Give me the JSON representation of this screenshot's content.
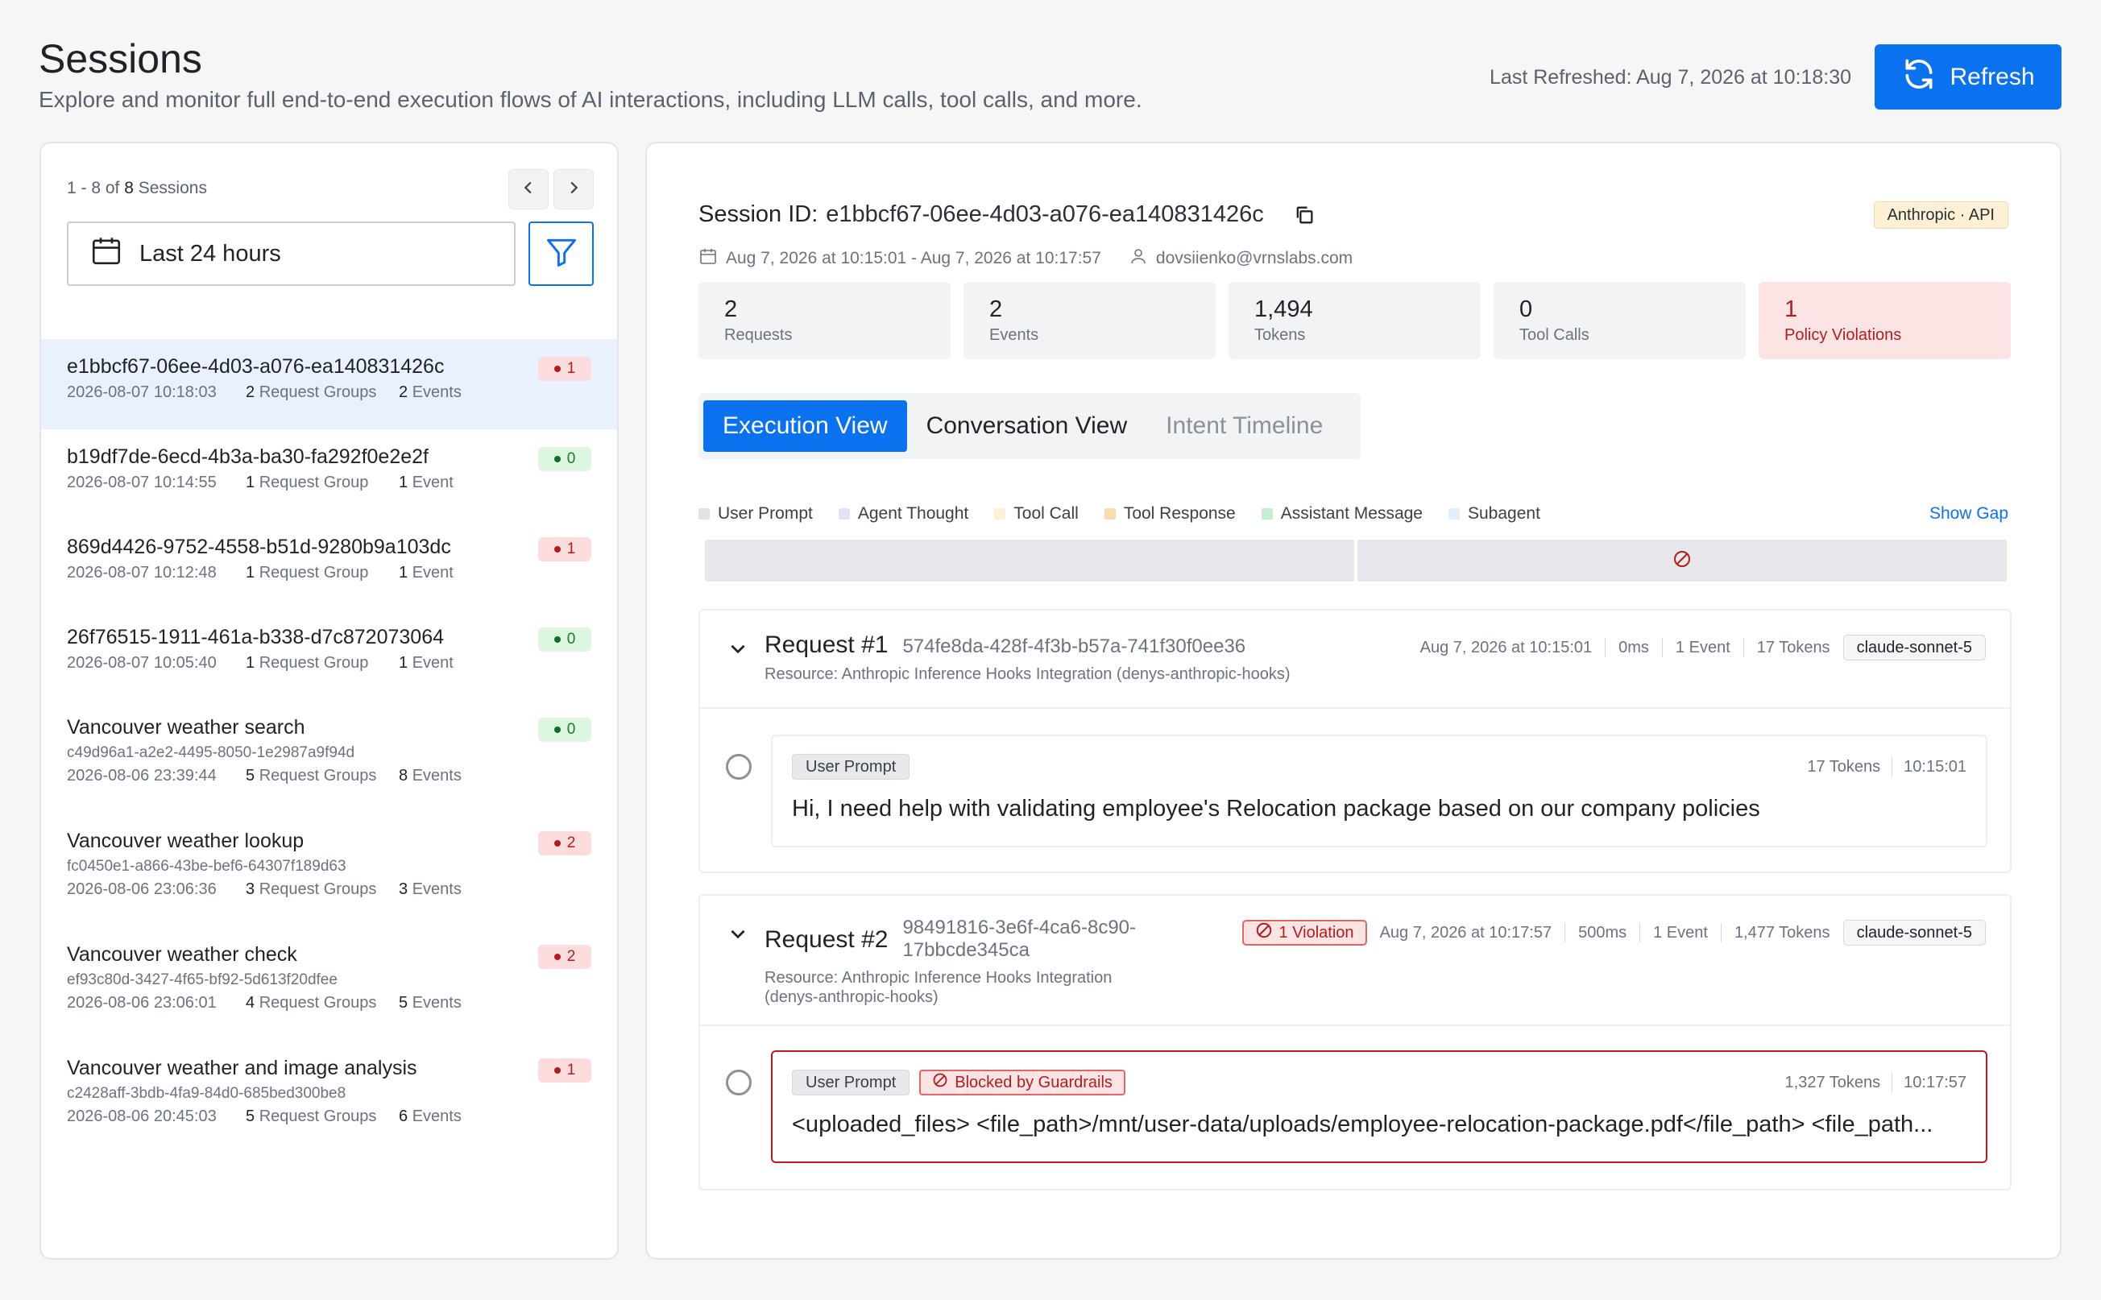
{
  "header": {
    "title": "Sessions",
    "subtitle": "Explore and monitor full end-to-end execution flows of AI interactions, including LLM calls, tool calls, and more.",
    "last_refreshed": "Last Refreshed: Aug 7, 2026 at 10:18:30",
    "refresh_label": "Refresh",
    "accent": "#0a72ef"
  },
  "left": {
    "count_prefix": "1 - 8 of",
    "count_total": "8",
    "count_suffix": "Sessions",
    "date_filter": "Last 24 hours",
    "sessions": [
      {
        "title": "e1bbcf67-06ee-4d03-a076-ea140831426c",
        "sub": "",
        "time": "2026-08-07 10:18:03",
        "groups_n": "2",
        "groups_label": "Request Groups",
        "events_n": "2",
        "events_label": "Events",
        "badge": "1",
        "badge_color": "red",
        "selected": true
      },
      {
        "title": "b19df7de-6ecd-4b3a-ba30-fa292f0e2e2f",
        "sub": "",
        "time": "2026-08-07 10:14:55",
        "groups_n": "1",
        "groups_label": "Request Group",
        "events_n": "1",
        "events_label": "Event",
        "badge": "0",
        "badge_color": "green"
      },
      {
        "title": "869d4426-9752-4558-b51d-9280b9a103dc",
        "sub": "",
        "time": "2026-08-07 10:12:48",
        "groups_n": "1",
        "groups_label": "Request Group",
        "events_n": "1",
        "events_label": "Event",
        "badge": "1",
        "badge_color": "red"
      },
      {
        "title": "26f76515-1911-461a-b338-d7c872073064",
        "sub": "",
        "time": "2026-08-07 10:05:40",
        "groups_n": "1",
        "groups_label": "Request Group",
        "events_n": "1",
        "events_label": "Event",
        "badge": "0",
        "badge_color": "green"
      },
      {
        "title": "Vancouver weather search",
        "sub": "c49d96a1-a2e2-4495-8050-1e2987a9f94d",
        "time": "2026-08-06 23:39:44",
        "groups_n": "5",
        "groups_label": "Request Groups",
        "events_n": "8",
        "events_label": "Events",
        "badge": "0",
        "badge_color": "green"
      },
      {
        "title": "Vancouver weather lookup",
        "sub": "fc0450e1-a866-43be-bef6-64307f189d63",
        "time": "2026-08-06 23:06:36",
        "groups_n": "3",
        "groups_label": "Request Groups",
        "events_n": "3",
        "events_label": "Events",
        "badge": "2",
        "badge_color": "red"
      },
      {
        "title": "Vancouver weather check",
        "sub": "ef93c80d-3427-4f65-bf92-5d613f20dfee",
        "time": "2026-08-06 23:06:01",
        "groups_n": "4",
        "groups_label": "Request Groups",
        "events_n": "5",
        "events_label": "Events",
        "badge": "2",
        "badge_color": "red"
      },
      {
        "title": "Vancouver weather and image analysis",
        "sub": "c2428aff-3bdb-4fa9-84d0-685bed300be8",
        "time": "2026-08-06 20:45:03",
        "groups_n": "5",
        "groups_label": "Request Groups",
        "events_n": "6",
        "events_label": "Events",
        "badge": "1",
        "badge_color": "red"
      }
    ]
  },
  "detail": {
    "session_label": "Session ID:",
    "session_id": "e1bbcf67-06ee-4d03-a076-ea140831426c",
    "provider": "Anthropic · API",
    "time_range": "Aug 7, 2026 at 10:15:01 - Aug 7, 2026 at 10:17:57",
    "user": "dovsiienko@vrnslabs.com",
    "stats": [
      {
        "value": "2",
        "label": "Requests"
      },
      {
        "value": "2",
        "label": "Events"
      },
      {
        "value": "1,494",
        "label": "Tokens"
      },
      {
        "value": "0",
        "label": "Tool Calls"
      },
      {
        "value": "1",
        "label": "Policy Violations"
      }
    ],
    "tabs": [
      "Execution View",
      "Conversation View",
      "Intent Timeline"
    ],
    "legend": [
      {
        "label": "User Prompt",
        "color": "#dfe2e6"
      },
      {
        "label": "Agent Thought",
        "color": "#e4e2f7"
      },
      {
        "label": "Tool Call",
        "color": "#fdf1d3"
      },
      {
        "label": "Tool Response",
        "color": "#fbdcb0"
      },
      {
        "label": "Assistant Message",
        "color": "#c8ecd0"
      },
      {
        "label": "Subagent",
        "color": "#e1eefc"
      }
    ],
    "show_gap": "Show Gap",
    "requests": [
      {
        "title": "Request #1",
        "uuid": "574fe8da-428f-4f3b-b57a-741f30f0ee36",
        "resource": "Resource: Anthropic Inference Hooks Integration (denys-anthropic-hooks)",
        "time": "Aug 7, 2026 at 10:15:01",
        "duration": "0ms",
        "events": "1 Event",
        "tokens": "17 Tokens",
        "model": "claude-sonnet-5",
        "event": {
          "tag": "User Prompt",
          "tokens": "17 Tokens",
          "time": "10:15:01",
          "text": "Hi, I need help with validating employee's Relocation package based on our company policies"
        }
      },
      {
        "title": "Request #2",
        "uuid_line1": "98491816-3e6f-4ca6-8c90-",
        "uuid_line2": "17bbcde345ca",
        "resource_line1": "Resource: Anthropic Inference Hooks Integration",
        "resource_line2": "(denys-anthropic-hooks)",
        "violation": "1 Violation",
        "time": "Aug 7, 2026 at 10:17:57",
        "duration": "500ms",
        "events": "1 Event",
        "tokens": "1,477 Tokens",
        "model": "claude-sonnet-5",
        "event": {
          "tag": "User Prompt",
          "blocked": "Blocked by Guardrails",
          "tokens": "1,327 Tokens",
          "time": "10:17:57",
          "text": "<uploaded_files> <file_path>/mnt/user-data/uploads/employee-relocation-package.pdf</file_path> <file_path..."
        }
      }
    ]
  }
}
